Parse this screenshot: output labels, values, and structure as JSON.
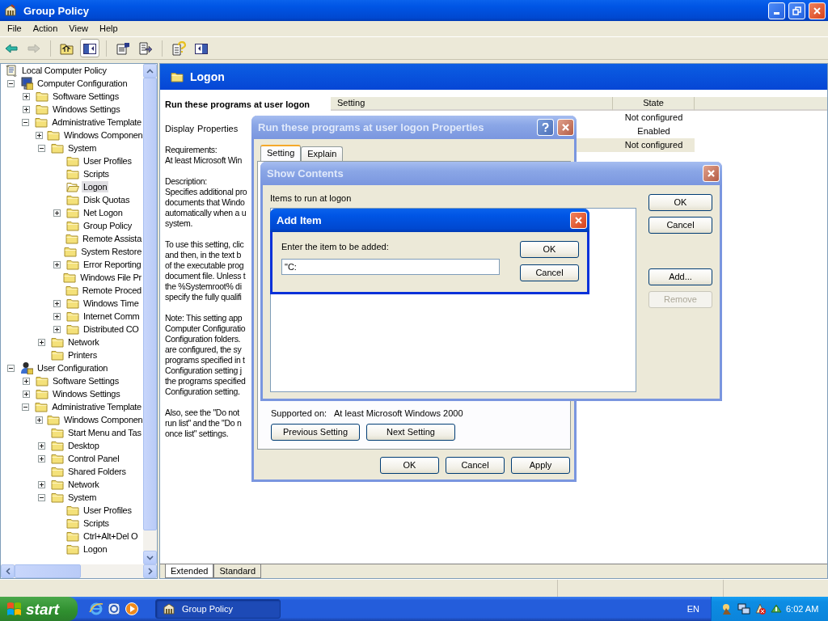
{
  "window": {
    "title": "Group Policy",
    "active": true
  },
  "menu": [
    "File",
    "Action",
    "View",
    "Help"
  ],
  "toolbar": [
    {
      "kind": "back",
      "disabled": false,
      "pressed": false
    },
    {
      "kind": "forward",
      "disabled": true,
      "pressed": false
    },
    {
      "kind": "up",
      "disabled": false,
      "pressed": false
    },
    {
      "kind": "tree",
      "disabled": false,
      "pressed": true
    },
    {
      "kind": "properties",
      "disabled": false,
      "pressed": false
    },
    {
      "kind": "export",
      "disabled": false,
      "pressed": false
    },
    {
      "kind": "help",
      "disabled": false,
      "pressed": false
    },
    {
      "kind": "pane",
      "disabled": false,
      "pressed": false
    }
  ],
  "tree": [
    {
      "label": "Local Computer Policy",
      "kind": "policy",
      "selected": false,
      "children": [
        {
          "label": "Computer Configuration",
          "kind": "computer",
          "expanded": true,
          "selected": false,
          "children": [
            {
              "label": "Software Settings",
              "kind": "folder",
              "expanded": false,
              "selected": false
            },
            {
              "label": "Windows Settings",
              "kind": "folder",
              "expanded": false,
              "selected": false
            },
            {
              "label": "Administrative Template",
              "kind": "folder",
              "expanded": true,
              "selected": false,
              "children": [
                {
                  "label": "Windows Componen",
                  "kind": "folder",
                  "expanded": false,
                  "selected": false
                },
                {
                  "label": "System",
                  "kind": "folder",
                  "expanded": true,
                  "selected": false,
                  "children": [
                    {
                      "label": "User Profiles",
                      "kind": "folder",
                      "selected": false
                    },
                    {
                      "label": "Scripts",
                      "kind": "folder",
                      "selected": false
                    },
                    {
                      "label": "Logon",
                      "kind": "folder",
                      "selected": true
                    },
                    {
                      "label": "Disk Quotas",
                      "kind": "folder",
                      "selected": false
                    },
                    {
                      "label": "Net Logon",
                      "kind": "folder",
                      "expanded": false,
                      "selected": false
                    },
                    {
                      "label": "Group Policy",
                      "kind": "folder",
                      "selected": false
                    },
                    {
                      "label": "Remote Assista",
                      "kind": "folder",
                      "selected": false
                    },
                    {
                      "label": "System Restore",
                      "kind": "folder",
                      "selected": false
                    },
                    {
                      "label": "Error Reporting",
                      "kind": "folder",
                      "expanded": false,
                      "selected": false
                    },
                    {
                      "label": "Windows File Pr",
                      "kind": "folder",
                      "selected": false
                    },
                    {
                      "label": "Remote Proced",
                      "kind": "folder",
                      "selected": false
                    },
                    {
                      "label": "Windows Time",
                      "kind": "folder",
                      "expanded": false,
                      "selected": false
                    },
                    {
                      "label": "Internet Comm",
                      "kind": "folder",
                      "expanded": false,
                      "selected": false
                    },
                    {
                      "label": "Distributed CO",
                      "kind": "folder",
                      "expanded": false,
                      "selected": false
                    }
                  ]
                },
                {
                  "label": "Network",
                  "kind": "folder",
                  "expanded": false,
                  "selected": false
                },
                {
                  "label": "Printers",
                  "kind": "folder",
                  "selected": false
                }
              ]
            }
          ]
        },
        {
          "label": "User Configuration",
          "kind": "user",
          "expanded": true,
          "selected": false,
          "children": [
            {
              "label": "Software Settings",
              "kind": "folder",
              "expanded": false,
              "selected": false
            },
            {
              "label": "Windows Settings",
              "kind": "folder",
              "expanded": false,
              "selected": false
            },
            {
              "label": "Administrative Template",
              "kind": "folder",
              "expanded": true,
              "selected": false,
              "children": [
                {
                  "label": "Windows Componen",
                  "kind": "folder",
                  "expanded": false,
                  "selected": false
                },
                {
                  "label": "Start Menu and Tas",
                  "kind": "folder",
                  "selected": false
                },
                {
                  "label": "Desktop",
                  "kind": "folder",
                  "expanded": false,
                  "selected": false
                },
                {
                  "label": "Control Panel",
                  "kind": "folder",
                  "expanded": false,
                  "selected": false
                },
                {
                  "label": "Shared Folders",
                  "kind": "folder",
                  "selected": false
                },
                {
                  "label": "Network",
                  "kind": "folder",
                  "expanded": false,
                  "selected": false
                },
                {
                  "label": "System",
                  "kind": "folder",
                  "expanded": true,
                  "selected": false,
                  "children": [
                    {
                      "label": "User Profiles",
                      "kind": "folder",
                      "selected": false
                    },
                    {
                      "label": "Scripts",
                      "kind": "folder",
                      "selected": false
                    },
                    {
                      "label": "Ctrl+Alt+Del O",
                      "kind": "folder",
                      "selected": false
                    },
                    {
                      "label": "Logon",
                      "kind": "folder",
                      "selected": false
                    }
                  ]
                }
              ]
            }
          ]
        }
      ]
    }
  ],
  "details": {
    "header": "Logon",
    "title": "Run these programs at user logon",
    "display_label": "Display",
    "display_link": "Properties",
    "paragraphs": [
      [
        "Requirements:",
        "At least Microsoft Win"
      ],
      [
        "Description:",
        "Specifies additional pro",
        "documents that Windo",
        "automatically when a u",
        "system."
      ],
      [
        "To use this setting, clic",
        "and then, in the text b",
        "of the executable prog",
        "document file. Unless t",
        "the %Systemroot% di",
        "specify the fully qualifi"
      ],
      [
        "Note: This setting app",
        "Computer Configuratio",
        "Configuration folders.",
        "are configured, the sy",
        "programs specified in t",
        "Configuration setting j",
        "the programs specified",
        "Configuration setting."
      ],
      [
        "Also, see the \"Do not",
        "run list\" and the \"Do n",
        "once list\" settings."
      ]
    ]
  },
  "table": {
    "columns": [
      "Setting",
      "State"
    ],
    "rows": [
      {
        "state": "Not configured",
        "selected": false
      },
      {
        "state": "Enabled",
        "selected": false
      },
      {
        "state": "Not configured",
        "selected": true
      }
    ]
  },
  "view_tabs": [
    {
      "label": "Extended",
      "selected": true
    },
    {
      "label": "Standard",
      "selected": false
    }
  ],
  "properties_dialog": {
    "title": "Run these programs at user logon Properties",
    "active": false,
    "tabs": [
      {
        "label": "Setting",
        "selected": true
      },
      {
        "label": "Explain",
        "selected": false
      }
    ],
    "supported_label": "Supported on:",
    "supported_value": "At least Microsoft Windows 2000",
    "nav_buttons": [
      "Previous Setting",
      "Next Setting"
    ],
    "buttons": [
      "OK",
      "Cancel",
      "Apply"
    ]
  },
  "show_contents": {
    "title": "Show Contents",
    "active": false,
    "list_label": "Items to run at logon",
    "buttons": [
      {
        "label": "OK",
        "disabled": false
      },
      {
        "label": "Cancel",
        "disabled": false
      },
      {
        "label": "Add...",
        "disabled": false
      },
      {
        "label": "Remove",
        "disabled": true
      }
    ]
  },
  "add_item": {
    "title": "Add Item",
    "active": true,
    "prompt": "Enter the item to be added:",
    "value": "\"C:",
    "buttons": [
      "OK",
      "Cancel"
    ]
  },
  "taskbar": {
    "start": "start",
    "tasks": [
      {
        "label": "Group Policy",
        "selected": true
      }
    ],
    "language": "EN",
    "clock": "6:02 AM"
  }
}
